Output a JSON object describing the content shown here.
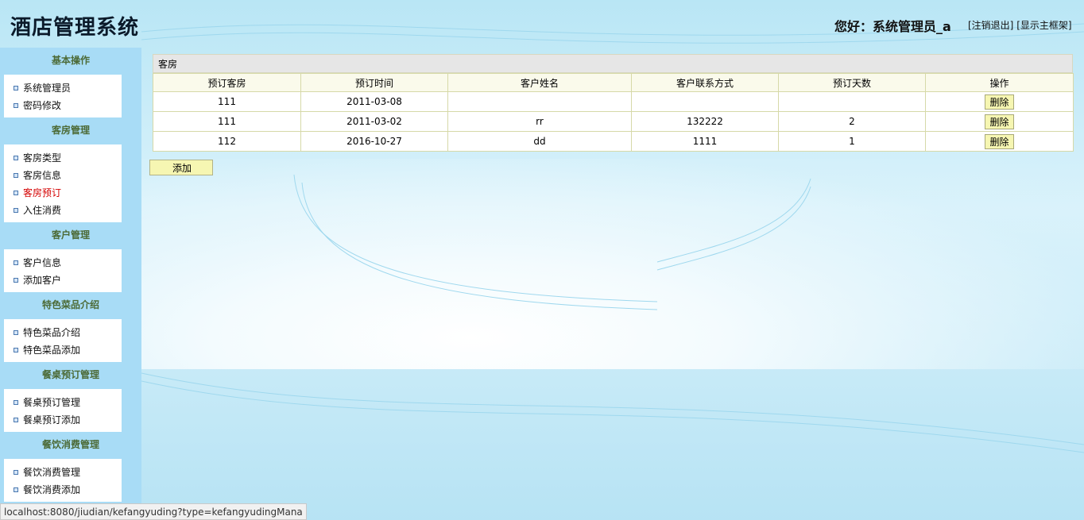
{
  "header": {
    "title": "酒店管理系统",
    "greeting": "您好：系统管理员_a",
    "logout_link": "[注销退出]",
    "show_frame_link": "[显示主框架]"
  },
  "sidebar": {
    "sections": [
      {
        "title": "基本操作",
        "items": [
          "系统管理员",
          "密码修改"
        ]
      },
      {
        "title": "客房管理",
        "items": [
          "客房类型",
          "客房信息",
          "客房预订",
          "入住消费"
        ]
      },
      {
        "title": "客户管理",
        "items": [
          "客户信息",
          "添加客户"
        ]
      },
      {
        "title": "特色菜品介绍",
        "items": [
          "特色菜品介绍",
          "特色菜品添加"
        ]
      },
      {
        "title": "餐桌预订管理",
        "items": [
          "餐桌预订管理",
          "餐桌预订添加"
        ]
      },
      {
        "title": "餐饮消费管理",
        "items": [
          "餐饮消费管理",
          "餐饮消费添加"
        ]
      }
    ],
    "active_item": "客房预订"
  },
  "main": {
    "panel_title": "客房",
    "columns": [
      "预订客房",
      "预订时间",
      "客户姓名",
      "客户联系方式",
      "预订天数",
      "操作"
    ],
    "rows": [
      {
        "room": "111",
        "date": "2011-03-08",
        "name": "",
        "contact": "",
        "days": "",
        "action": "删除"
      },
      {
        "room": "111",
        "date": "2011-03-02",
        "name": "rr",
        "contact": "132222",
        "days": "2",
        "action": "删除"
      },
      {
        "room": "112",
        "date": "2016-10-27",
        "name": "dd",
        "contact": "1111",
        "days": "1",
        "action": "删除"
      }
    ],
    "add_label": "添加"
  },
  "status_bar": {
    "url": "localhost:8080/jiudian/kefangyuding?type=kefangyudingMana"
  },
  "colors": {
    "sidebar_bg": "#a8dcf6",
    "section_title": "#4c6a36",
    "active_item": "#d40000",
    "button_bg": "#f6f6b2"
  }
}
